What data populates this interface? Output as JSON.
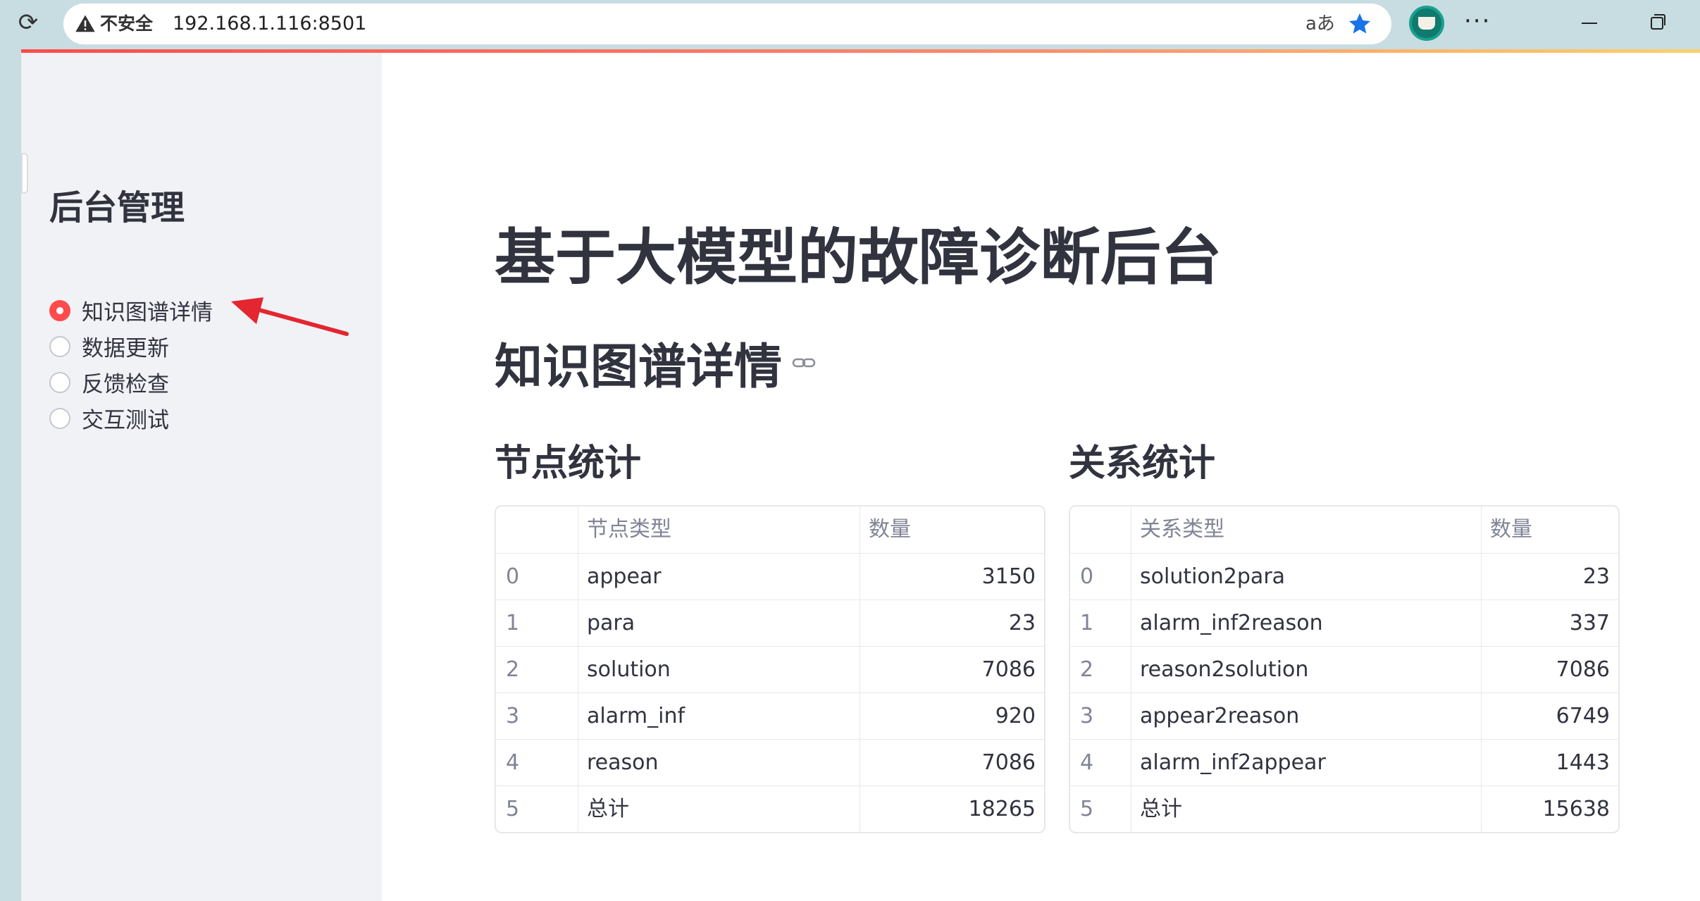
{
  "browser": {
    "security_label": "不安全",
    "url": "192.168.1.116:8501",
    "translate_glyph": "aあ",
    "more_glyph": "···"
  },
  "sidebar": {
    "title": "后台管理",
    "options": [
      {
        "label": "知识图谱详情",
        "selected": true
      },
      {
        "label": "数据更新",
        "selected": false
      },
      {
        "label": "反馈检查",
        "selected": false
      },
      {
        "label": "交互测试",
        "selected": false
      }
    ]
  },
  "main": {
    "title": "基于大模型的故障诊断后台",
    "section": "知识图谱详情",
    "node_stats": {
      "title": "节点统计",
      "headers": [
        "",
        "节点类型",
        "数量"
      ],
      "rows": [
        [
          "0",
          "appear",
          "3150"
        ],
        [
          "1",
          "para",
          "23"
        ],
        [
          "2",
          "solution",
          "7086"
        ],
        [
          "3",
          "alarm_inf",
          "920"
        ],
        [
          "4",
          "reason",
          "7086"
        ],
        [
          "5",
          "总计",
          "18265"
        ]
      ]
    },
    "relation_stats": {
      "title": "关系统计",
      "headers": [
        "",
        "关系类型",
        "数量"
      ],
      "rows": [
        [
          "0",
          "solution2para",
          "23"
        ],
        [
          "1",
          "alarm_inf2reason",
          "337"
        ],
        [
          "2",
          "reason2solution",
          "7086"
        ],
        [
          "3",
          "appear2reason",
          "6749"
        ],
        [
          "4",
          "alarm_inf2appear",
          "1443"
        ],
        [
          "5",
          "总计",
          "15638"
        ]
      ]
    }
  },
  "colors": {
    "accent": "#ff4b4b",
    "annotation_arrow": "#e3262f",
    "sidebar_bg": "#f0f2f6",
    "text": "#31333f"
  }
}
